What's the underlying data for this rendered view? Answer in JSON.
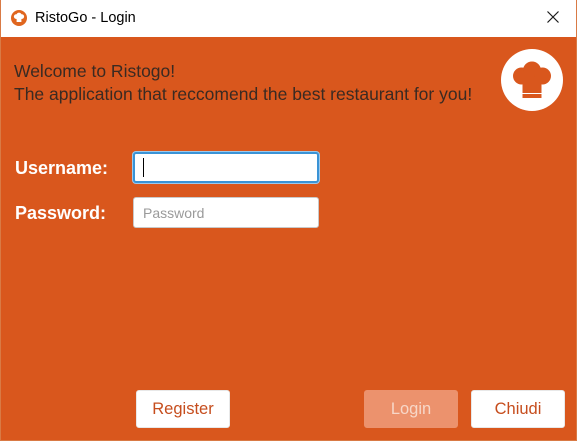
{
  "window": {
    "title": "RistoGo - Login",
    "app_icon": "chef-hat-icon",
    "close_icon": "close-icon"
  },
  "header": {
    "welcome_line1": "Welcome to Ristogo!",
    "welcome_line2": "The application that reccomend the best restaurant for you!",
    "logo_icon": "chef-hat-icon"
  },
  "form": {
    "username_label": "Username:",
    "username_value": "",
    "username_placeholder": "",
    "password_label": "Password:",
    "password_value": "",
    "password_placeholder": "Password"
  },
  "buttons": {
    "register": "Register",
    "login": "Login",
    "close": "Chiudi"
  },
  "colors": {
    "background": "#d9571d",
    "accent_text": "#c64d1d",
    "focus_border": "#3a93d6",
    "disabled_button": "#ec926d"
  }
}
